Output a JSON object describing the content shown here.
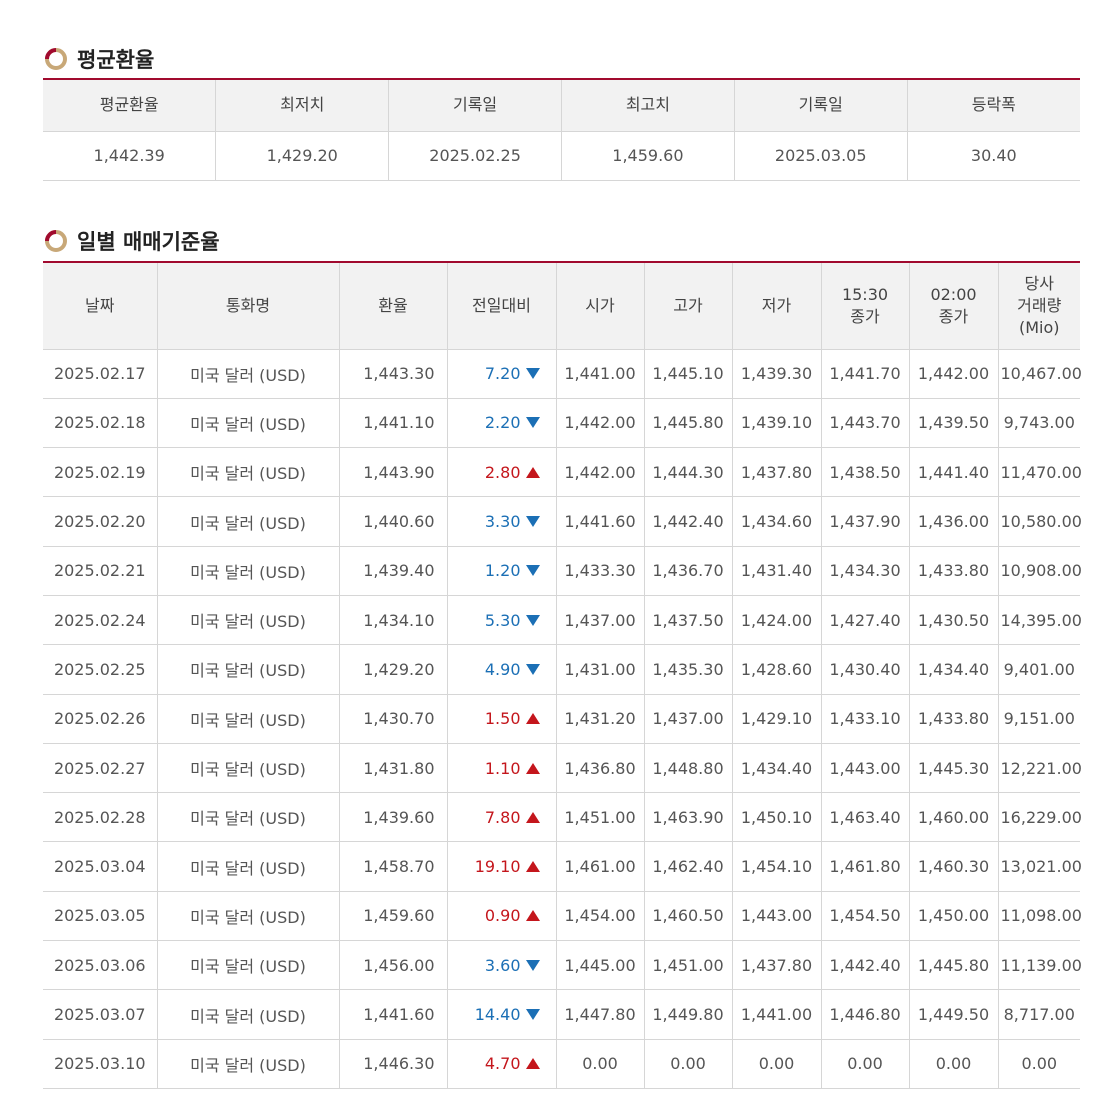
{
  "average_section": {
    "title": "평균환율",
    "headers": [
      "평균환율",
      "최저치",
      "기록일",
      "최고치",
      "기록일",
      "등락폭"
    ],
    "values": [
      "1,442.39",
      "1,429.20",
      "2025.02.25",
      "1,459.60",
      "2025.03.05",
      "30.40"
    ]
  },
  "daily_section": {
    "title": "일별 매매기준율",
    "headers": [
      "날짜",
      "통화명",
      "환율",
      "전일대비",
      "시가",
      "고가",
      "저가",
      "15:30\n종가",
      "02:00\n종가",
      "당사\n거래량\n(Mio)"
    ],
    "rows": [
      {
        "date": "2025.02.17",
        "currency": "미국 달러 (USD)",
        "rate": "1,443.30",
        "change": "7.20",
        "dir": "down",
        "open": "1,441.00",
        "high": "1,445.10",
        "low": "1,439.30",
        "close1530": "1,441.70",
        "close0200": "1,442.00",
        "volume": "10,467.00"
      },
      {
        "date": "2025.02.18",
        "currency": "미국 달러 (USD)",
        "rate": "1,441.10",
        "change": "2.20",
        "dir": "down",
        "open": "1,442.00",
        "high": "1,445.80",
        "low": "1,439.10",
        "close1530": "1,443.70",
        "close0200": "1,439.50",
        "volume": "9,743.00"
      },
      {
        "date": "2025.02.19",
        "currency": "미국 달러 (USD)",
        "rate": "1,443.90",
        "change": "2.80",
        "dir": "up",
        "open": "1,442.00",
        "high": "1,444.30",
        "low": "1,437.80",
        "close1530": "1,438.50",
        "close0200": "1,441.40",
        "volume": "11,470.00"
      },
      {
        "date": "2025.02.20",
        "currency": "미국 달러 (USD)",
        "rate": "1,440.60",
        "change": "3.30",
        "dir": "down",
        "open": "1,441.60",
        "high": "1,442.40",
        "low": "1,434.60",
        "close1530": "1,437.90",
        "close0200": "1,436.00",
        "volume": "10,580.00"
      },
      {
        "date": "2025.02.21",
        "currency": "미국 달러 (USD)",
        "rate": "1,439.40",
        "change": "1.20",
        "dir": "down",
        "open": "1,433.30",
        "high": "1,436.70",
        "low": "1,431.40",
        "close1530": "1,434.30",
        "close0200": "1,433.80",
        "volume": "10,908.00"
      },
      {
        "date": "2025.02.24",
        "currency": "미국 달러 (USD)",
        "rate": "1,434.10",
        "change": "5.30",
        "dir": "down",
        "open": "1,437.00",
        "high": "1,437.50",
        "low": "1,424.00",
        "close1530": "1,427.40",
        "close0200": "1,430.50",
        "volume": "14,395.00"
      },
      {
        "date": "2025.02.25",
        "currency": "미국 달러 (USD)",
        "rate": "1,429.20",
        "change": "4.90",
        "dir": "down",
        "open": "1,431.00",
        "high": "1,435.30",
        "low": "1,428.60",
        "close1530": "1,430.40",
        "close0200": "1,434.40",
        "volume": "9,401.00"
      },
      {
        "date": "2025.02.26",
        "currency": "미국 달러 (USD)",
        "rate": "1,430.70",
        "change": "1.50",
        "dir": "up",
        "open": "1,431.20",
        "high": "1,437.00",
        "low": "1,429.10",
        "close1530": "1,433.10",
        "close0200": "1,433.80",
        "volume": "9,151.00"
      },
      {
        "date": "2025.02.27",
        "currency": "미국 달러 (USD)",
        "rate": "1,431.80",
        "change": "1.10",
        "dir": "up",
        "open": "1,436.80",
        "high": "1,448.80",
        "low": "1,434.40",
        "close1530": "1,443.00",
        "close0200": "1,445.30",
        "volume": "12,221.00"
      },
      {
        "date": "2025.02.28",
        "currency": "미국 달러 (USD)",
        "rate": "1,439.60",
        "change": "7.80",
        "dir": "up",
        "open": "1,451.00",
        "high": "1,463.90",
        "low": "1,450.10",
        "close1530": "1,463.40",
        "close0200": "1,460.00",
        "volume": "16,229.00"
      },
      {
        "date": "2025.03.04",
        "currency": "미국 달러 (USD)",
        "rate": "1,458.70",
        "change": "19.10",
        "dir": "up",
        "open": "1,461.00",
        "high": "1,462.40",
        "low": "1,454.10",
        "close1530": "1,461.80",
        "close0200": "1,460.30",
        "volume": "13,021.00"
      },
      {
        "date": "2025.03.05",
        "currency": "미국 달러 (USD)",
        "rate": "1,459.60",
        "change": "0.90",
        "dir": "up",
        "open": "1,454.00",
        "high": "1,460.50",
        "low": "1,443.00",
        "close1530": "1,454.50",
        "close0200": "1,450.00",
        "volume": "11,098.00"
      },
      {
        "date": "2025.03.06",
        "currency": "미국 달러 (USD)",
        "rate": "1,456.00",
        "change": "3.60",
        "dir": "down",
        "open": "1,445.00",
        "high": "1,451.00",
        "low": "1,437.80",
        "close1530": "1,442.40",
        "close0200": "1,445.80",
        "volume": "11,139.00"
      },
      {
        "date": "2025.03.07",
        "currency": "미국 달러 (USD)",
        "rate": "1,441.60",
        "change": "14.40",
        "dir": "down",
        "open": "1,447.80",
        "high": "1,449.80",
        "low": "1,441.00",
        "close1530": "1,446.80",
        "close0200": "1,449.50",
        "volume": "8,717.00"
      },
      {
        "date": "2025.03.10",
        "currency": "미국 달러 (USD)",
        "rate": "1,446.30",
        "change": "4.70",
        "dir": "up",
        "open": "0.00",
        "high": "0.00",
        "low": "0.00",
        "close1530": "0.00",
        "close0200": "0.00",
        "volume": "0.00"
      }
    ]
  },
  "colors": {
    "accent": "#a10a2e",
    "down": "#1b6fb5",
    "up": "#c4161c"
  }
}
